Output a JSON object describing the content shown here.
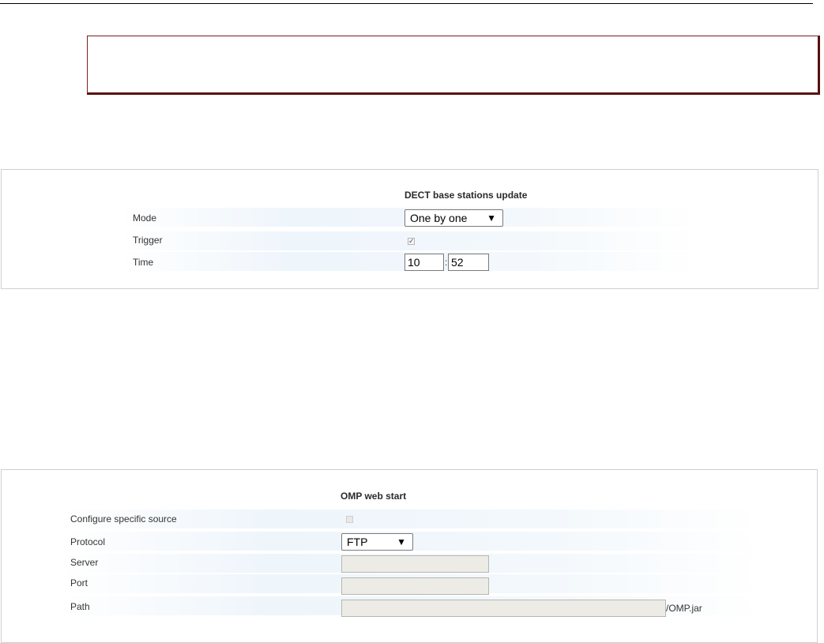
{
  "dect_panel": {
    "title": "DECT base stations update",
    "mode_label": "Mode",
    "mode_value": "One by one",
    "trigger_label": "Trigger",
    "trigger_checked": true,
    "time_label": "Time",
    "time_hour": "10",
    "time_sep": ":",
    "time_minute": "52",
    "arrow": "▼"
  },
  "omp_panel": {
    "title": "OMP web start",
    "specific_source_label": "Configure specific source",
    "specific_source_checked": false,
    "protocol_label": "Protocol",
    "protocol_value": "FTP",
    "server_label": "Server",
    "server_value": "",
    "port_label": "Port",
    "port_value": "",
    "path_label": "Path",
    "path_value": "",
    "path_suffix": "/OMP.jar",
    "arrow": "▼"
  },
  "colors": {
    "note_border": "#5a1010",
    "row_tint": "#eef5fb"
  }
}
